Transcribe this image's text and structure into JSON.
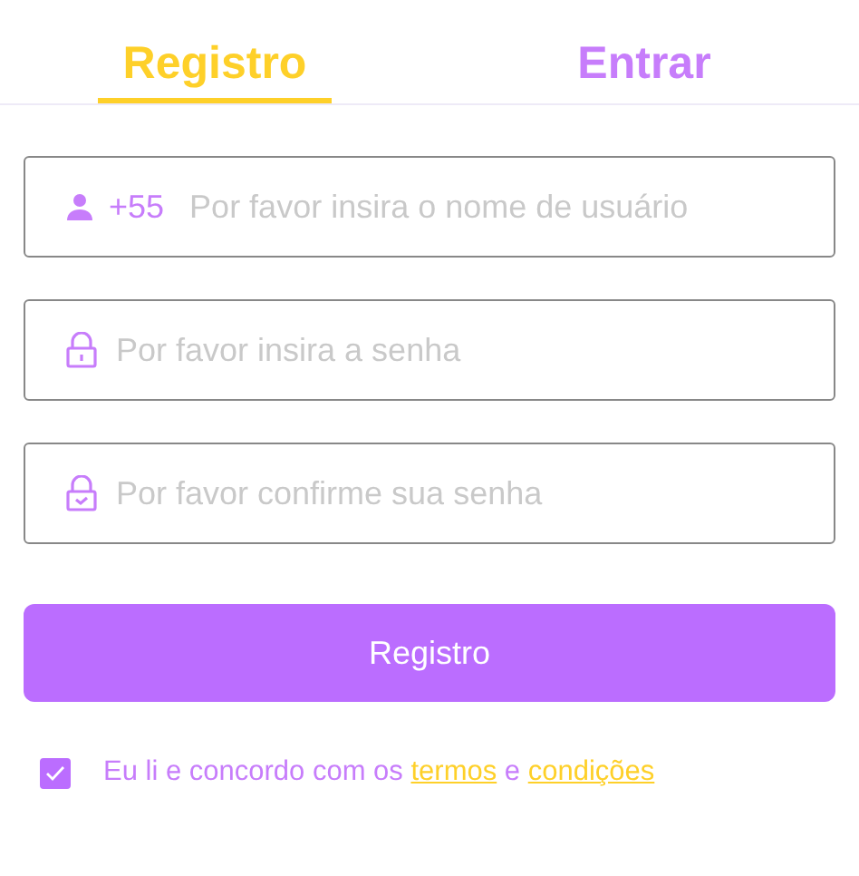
{
  "tabs": [
    {
      "label": "Registro",
      "selected": true
    },
    {
      "label": "Entrar",
      "selected": false
    }
  ],
  "fields": [
    {
      "kind": "user",
      "prefix": "+55",
      "placeholder": "Por favor insira o nome de usuário"
    },
    {
      "kind": "lock",
      "placeholder": "Por favor insira a senha"
    },
    {
      "kind": "confirm",
      "placeholder": "Por favor confirme sua senha"
    }
  ],
  "submit": "Registro",
  "agreement": {
    "checked": true,
    "text": "Eu li e concordo com os",
    "terms_link": "termos",
    "joiner": "e",
    "conditions_link": "condições"
  }
}
